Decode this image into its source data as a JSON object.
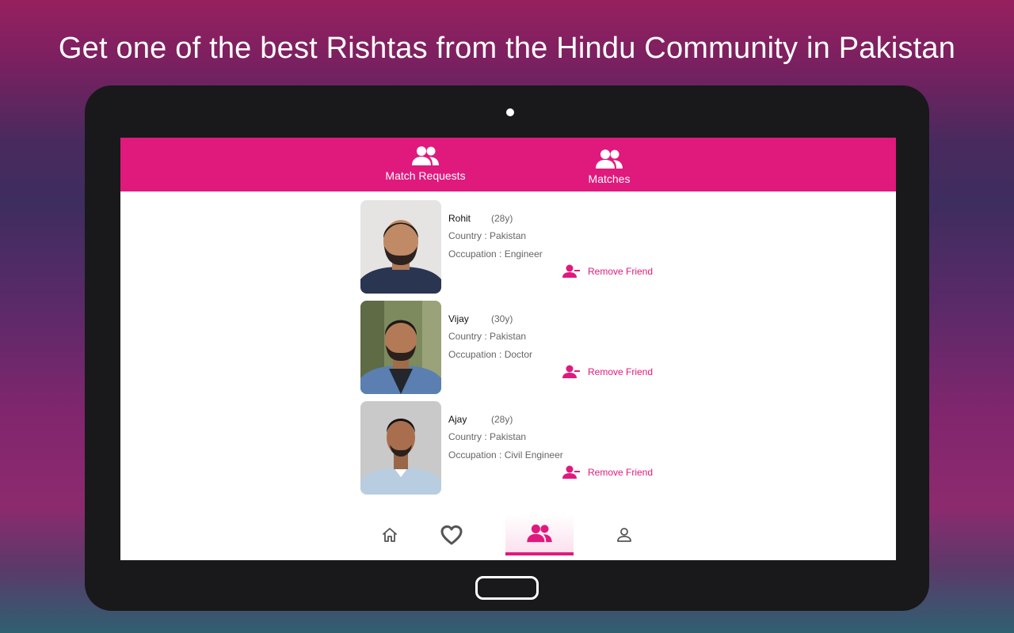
{
  "headline": "Get one of the best Rishtas from the Hindu Community in Pakistan",
  "colors": {
    "accent": "#e0197d",
    "tablet": "#19191b"
  },
  "tabs": [
    {
      "label": "Match Requests",
      "icon": "group-icon"
    },
    {
      "label": "Matches",
      "icon": "group-icon"
    }
  ],
  "matches": [
    {
      "name": "Rohit",
      "age": "(28y)",
      "country": "Country : Pakistan",
      "occupation": "Occupation : Engineer",
      "action": "Remove Friend"
    },
    {
      "name": "Vijay",
      "age": "(30y)",
      "country": "Country : Pakistan",
      "occupation": "Occupation : Doctor",
      "action": "Remove Friend"
    },
    {
      "name": "Ajay",
      "age": "(28y)",
      "country": "Country : Pakistan",
      "occupation": "Occupation : Civil Engineer",
      "action": "Remove Friend"
    }
  ],
  "bottom_nav": [
    {
      "icon": "home-icon",
      "active": false
    },
    {
      "icon": "heart-icon",
      "active": false
    },
    {
      "icon": "group-icon",
      "active": true
    },
    {
      "icon": "person-icon",
      "active": false
    }
  ]
}
